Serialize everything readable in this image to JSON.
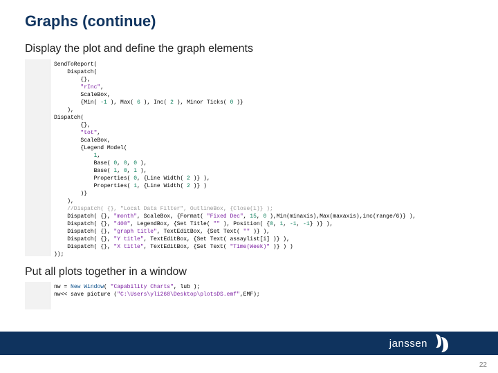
{
  "title": "Graphs (continue)",
  "subtitle1": "Display the plot and define the graph elements",
  "subtitle2": "Put all plots together in a window",
  "code1_lines": [
    {
      "indent": 0,
      "tokens": [
        {
          "t": "SendToReport(",
          "c": "fn"
        }
      ]
    },
    {
      "indent": 1,
      "tokens": [
        {
          "t": "Dispatch(",
          "c": "fn"
        }
      ]
    },
    {
      "indent": 2,
      "tokens": [
        {
          "t": "{},",
          "c": "fn"
        }
      ]
    },
    {
      "indent": 2,
      "tokens": [
        {
          "t": "\"rInc\"",
          "c": "str"
        },
        {
          "t": ",",
          "c": "fn"
        }
      ]
    },
    {
      "indent": 2,
      "tokens": [
        {
          "t": "ScaleBox,",
          "c": "fn"
        }
      ]
    },
    {
      "indent": 2,
      "tokens": [
        {
          "t": "{Min( ",
          "c": "fn"
        },
        {
          "t": "-1",
          "c": "num"
        },
        {
          "t": " ), Max( ",
          "c": "fn"
        },
        {
          "t": "6",
          "c": "num"
        },
        {
          "t": " ), Inc( ",
          "c": "fn"
        },
        {
          "t": "2",
          "c": "num"
        },
        {
          "t": " ), Minor Ticks( ",
          "c": "fn"
        },
        {
          "t": "0",
          "c": "num"
        },
        {
          "t": " )}",
          "c": "fn"
        }
      ]
    },
    {
      "indent": 1,
      "tokens": [
        {
          "t": "),",
          "c": "fn"
        }
      ]
    },
    {
      "indent": 0,
      "tokens": [
        {
          "t": "Dispatch(",
          "c": "fn"
        }
      ]
    },
    {
      "indent": 2,
      "tokens": [
        {
          "t": "{},",
          "c": "fn"
        }
      ]
    },
    {
      "indent": 2,
      "tokens": [
        {
          "t": "\"tot\"",
          "c": "str"
        },
        {
          "t": ",",
          "c": "fn"
        }
      ]
    },
    {
      "indent": 2,
      "tokens": [
        {
          "t": "ScaleBox,",
          "c": "fn"
        }
      ]
    },
    {
      "indent": 2,
      "tokens": [
        {
          "t": "{Legend Model(",
          "c": "fn"
        }
      ]
    },
    {
      "indent": 3,
      "tokens": [
        {
          "t": "1",
          "c": "num"
        },
        {
          "t": ",",
          "c": "fn"
        }
      ]
    },
    {
      "indent": 3,
      "tokens": [
        {
          "t": "Base( ",
          "c": "fn"
        },
        {
          "t": "0",
          "c": "num"
        },
        {
          "t": ", ",
          "c": "fn"
        },
        {
          "t": "0",
          "c": "num"
        },
        {
          "t": ", ",
          "c": "fn"
        },
        {
          "t": "0",
          "c": "num"
        },
        {
          "t": " ),",
          "c": "fn"
        }
      ]
    },
    {
      "indent": 3,
      "tokens": [
        {
          "t": "Base( ",
          "c": "fn"
        },
        {
          "t": "1",
          "c": "num"
        },
        {
          "t": ", ",
          "c": "fn"
        },
        {
          "t": "0",
          "c": "num"
        },
        {
          "t": ", ",
          "c": "fn"
        },
        {
          "t": "1",
          "c": "num"
        },
        {
          "t": " ),",
          "c": "fn"
        }
      ]
    },
    {
      "indent": 3,
      "tokens": [
        {
          "t": "Properties( ",
          "c": "fn"
        },
        {
          "t": "0",
          "c": "num"
        },
        {
          "t": ", {Line Width( ",
          "c": "fn"
        },
        {
          "t": "2",
          "c": "num"
        },
        {
          "t": " )} ),",
          "c": "fn"
        }
      ]
    },
    {
      "indent": 3,
      "tokens": [
        {
          "t": "Properties( ",
          "c": "fn"
        },
        {
          "t": "1",
          "c": "num"
        },
        {
          "t": ", {Line Width( ",
          "c": "fn"
        },
        {
          "t": "2",
          "c": "num"
        },
        {
          "t": " )} )",
          "c": "fn"
        }
      ]
    },
    {
      "indent": 2,
      "tokens": [
        {
          "t": ")}",
          "c": "fn"
        }
      ]
    },
    {
      "indent": 1,
      "tokens": [
        {
          "t": "),",
          "c": "fn"
        }
      ]
    },
    {
      "indent": 1,
      "tokens": [
        {
          "t": "//Dispatch( {}, \"Local Data Filter\", OutlineBox, {Close(1)} );",
          "c": "com"
        }
      ]
    },
    {
      "indent": 1,
      "tokens": [
        {
          "t": "Dispatch( {}, ",
          "c": "fn"
        },
        {
          "t": "\"month\"",
          "c": "str"
        },
        {
          "t": ", ScaleBox, {Format( ",
          "c": "fn"
        },
        {
          "t": "\"Fixed Dec\"",
          "c": "str"
        },
        {
          "t": ", ",
          "c": "fn"
        },
        {
          "t": "15",
          "c": "num"
        },
        {
          "t": ", ",
          "c": "fn"
        },
        {
          "t": "0",
          "c": "num"
        },
        {
          "t": " ),Min(minaxis),Max(maxaxis),inc(range/6)} ),",
          "c": "fn"
        }
      ]
    },
    {
      "indent": 1,
      "tokens": [
        {
          "t": "Dispatch( {}, ",
          "c": "fn"
        },
        {
          "t": "\"400\"",
          "c": "str"
        },
        {
          "t": ", LegendBox, {Set Title( ",
          "c": "fn"
        },
        {
          "t": "\"\"",
          "c": "str"
        },
        {
          "t": " ), Position( {",
          "c": "fn"
        },
        {
          "t": "0",
          "c": "num"
        },
        {
          "t": ", ",
          "c": "fn"
        },
        {
          "t": "1",
          "c": "num"
        },
        {
          "t": ", ",
          "c": "fn"
        },
        {
          "t": "-1",
          "c": "num"
        },
        {
          "t": ", ",
          "c": "fn"
        },
        {
          "t": "-1",
          "c": "num"
        },
        {
          "t": "} )} ),",
          "c": "fn"
        }
      ]
    },
    {
      "indent": 1,
      "tokens": [
        {
          "t": "Dispatch( {}, ",
          "c": "fn"
        },
        {
          "t": "\"graph title\"",
          "c": "str"
        },
        {
          "t": ", TextEditBox, {Set Text( ",
          "c": "fn"
        },
        {
          "t": "\"\"",
          "c": "str"
        },
        {
          "t": " )} ),",
          "c": "fn"
        }
      ]
    },
    {
      "indent": 1,
      "tokens": [
        {
          "t": "Dispatch( {}, ",
          "c": "fn"
        },
        {
          "t": "\"Y title\"",
          "c": "str"
        },
        {
          "t": ", TextEditBox, {Set Text( assaylist[i] )} ),",
          "c": "fn"
        }
      ]
    },
    {
      "indent": 1,
      "tokens": [
        {
          "t": "Dispatch( {}, ",
          "c": "fn"
        },
        {
          "t": "\"X title\"",
          "c": "str"
        },
        {
          "t": ", TextEditBox, {Set Text( ",
          "c": "fn"
        },
        {
          "t": "\"Time(Week)\"",
          "c": "str"
        },
        {
          "t": " )} ) )",
          "c": "fn"
        }
      ]
    },
    {
      "indent": 0,
      "tokens": [
        {
          "t": "));",
          "c": "fn"
        }
      ]
    }
  ],
  "code2_lines": [
    {
      "indent": 0,
      "tokens": [
        {
          "t": "nw = ",
          "c": "fn"
        },
        {
          "t": "New Window",
          "c": "kw"
        },
        {
          "t": "( ",
          "c": "fn"
        },
        {
          "t": "\"Capability Charts\"",
          "c": "str"
        },
        {
          "t": ", lub );",
          "c": "fn"
        }
      ]
    },
    {
      "indent": 0,
      "tokens": [
        {
          "t": "nw<< save picture (",
          "c": "fn"
        },
        {
          "t": "\"C:\\Users\\yli268\\Desktop\\plotsDS.emf\"",
          "c": "str"
        },
        {
          "t": ",EMF);",
          "c": "fn"
        }
      ]
    }
  ],
  "footer": {
    "brand": "janssen",
    "page_number": "22"
  }
}
